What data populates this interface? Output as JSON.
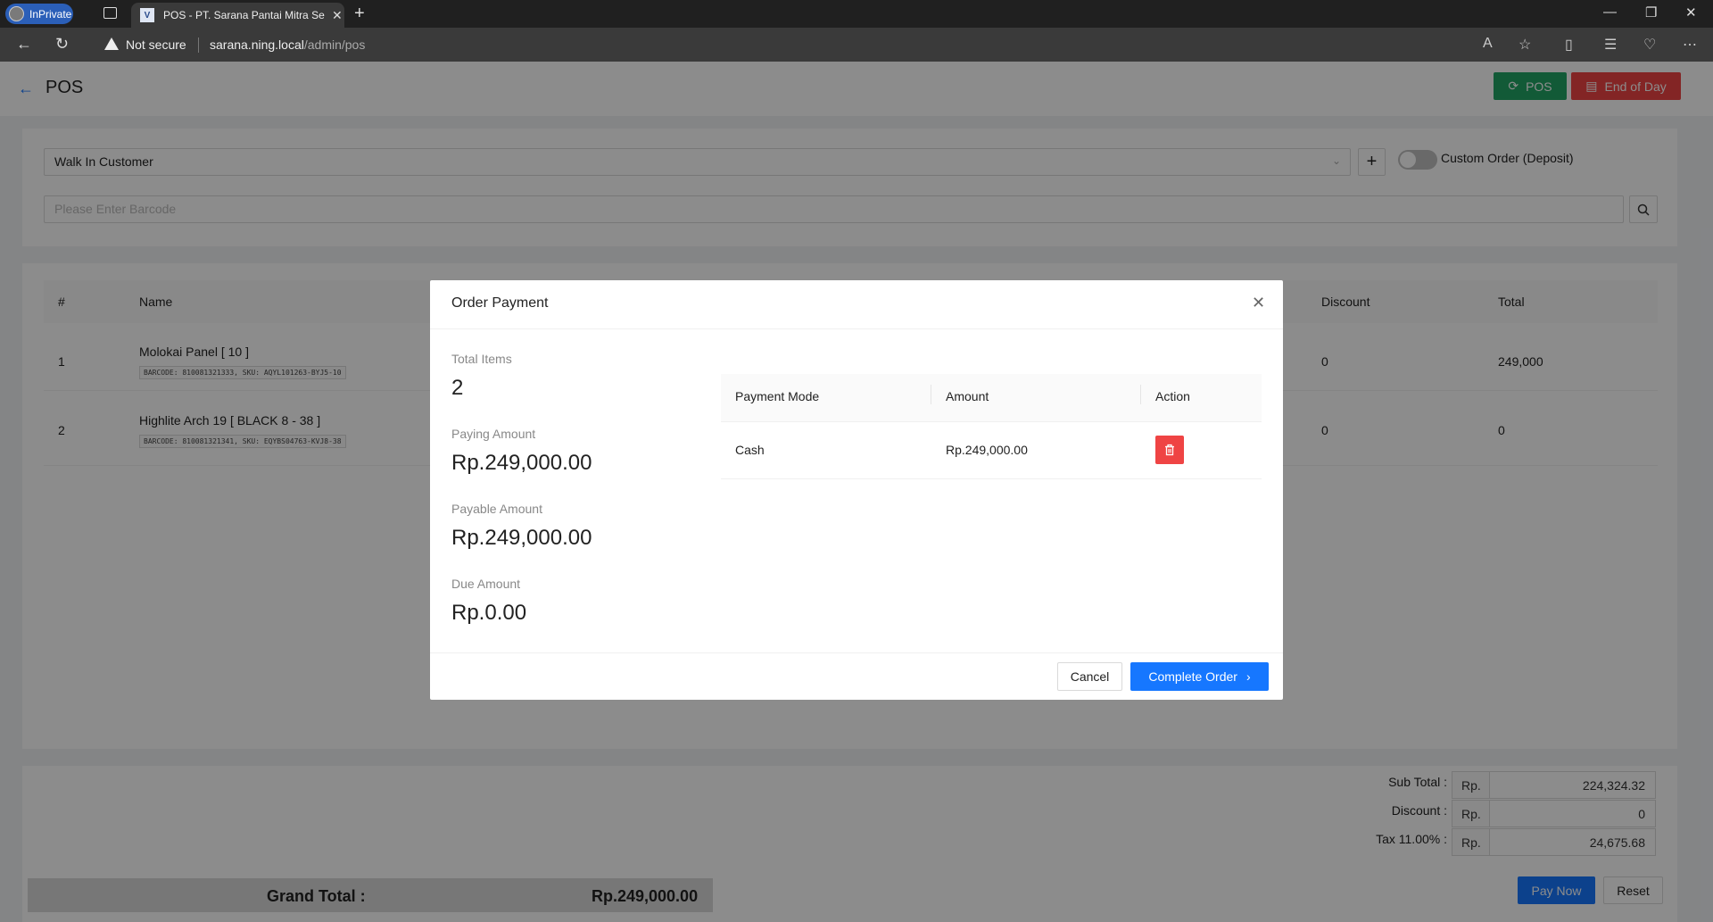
{
  "browser": {
    "inprivate_label": "InPrivate",
    "tab_title": "POS - PT. Sarana Pantai Mitra Se",
    "favicon_text": "V",
    "security_text": "Not secure",
    "url_host": "sarana.ning.local",
    "url_path": "/admin/pos"
  },
  "header": {
    "title": "POS",
    "pos_button": "POS",
    "eod_button": "End of Day"
  },
  "form": {
    "customer": "Walk In Customer",
    "custom_order_label": "Custom Order (Deposit)",
    "barcode_placeholder": "Please Enter Barcode"
  },
  "table": {
    "columns": [
      "#",
      "Name",
      "Discount",
      "Total"
    ],
    "rows": [
      {
        "no": "1",
        "name": "Molokai Panel [ 10 ]",
        "meta": "BARCODE: 810081321333, SKU: AQYL101263-BYJ5-10",
        "discount": "0",
        "total": "249,000"
      },
      {
        "no": "2",
        "name": "Highlite Arch 19 [ BLACK 8 - 38 ]",
        "meta": "BARCODE: 810081321341, SKU: EQYBS04763-KVJ8-38",
        "discount": "0",
        "total": "0"
      }
    ]
  },
  "summary": {
    "currency": "Rp.",
    "subtotal_label": "Sub Total :",
    "subtotal": "224,324.32",
    "discount_label": "Discount :",
    "discount": "0",
    "tax_label": "Tax 11.00% :",
    "tax": "24,675.68",
    "grand_label": "Grand Total :",
    "grand_value": "Rp.249,000.00",
    "pay_now": "Pay Now",
    "reset": "Reset"
  },
  "modal": {
    "title": "Order Payment",
    "total_items_label": "Total Items",
    "total_items": "2",
    "paying_label": "Paying Amount",
    "paying": "Rp.249,000.00",
    "payable_label": "Payable Amount",
    "payable": "Rp.249,000.00",
    "due_label": "Due Amount",
    "due": "Rp.0.00",
    "payments_columns": [
      "Payment Mode",
      "Amount",
      "Action"
    ],
    "payments": [
      {
        "mode": "Cash",
        "amount": "Rp.249,000.00"
      }
    ],
    "cancel": "Cancel",
    "complete": "Complete Order"
  },
  "colors": {
    "primary": "#1677ff",
    "success": "#22a565",
    "danger": "#ef4444"
  }
}
